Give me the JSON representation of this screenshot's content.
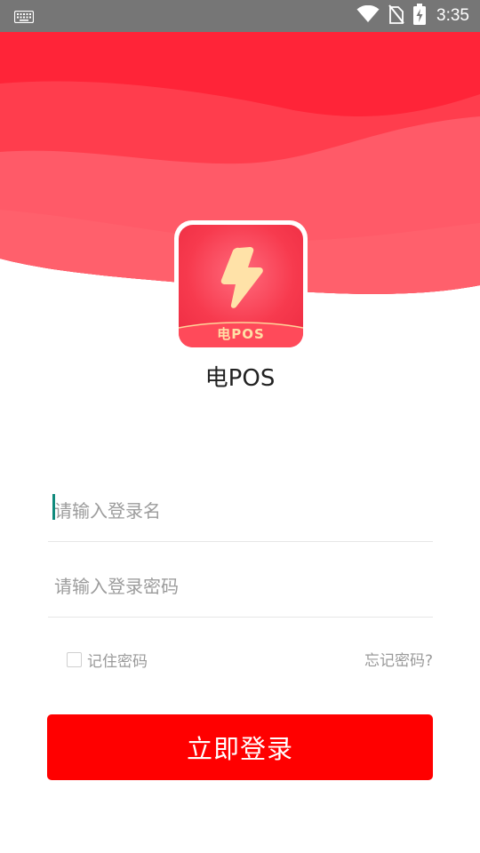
{
  "status_bar": {
    "time": "3:35",
    "icons": [
      "keyboard-icon",
      "wifi-icon",
      "no-sim-icon",
      "battery-charging-icon"
    ]
  },
  "app": {
    "icon_label": "电POS",
    "name": "电POS"
  },
  "login_form": {
    "username_placeholder": "请输入登录名",
    "password_placeholder": "请输入登录密码",
    "remember_label": "记住密码",
    "forgot_label": "忘记密码?",
    "login_button_label": "立即登录"
  },
  "colors": {
    "header_red": "#ff2438",
    "wave_light": "#ff5a68",
    "button_red": "#ff0000",
    "cursor_teal": "#108a7c",
    "status_bar": "#767676"
  }
}
